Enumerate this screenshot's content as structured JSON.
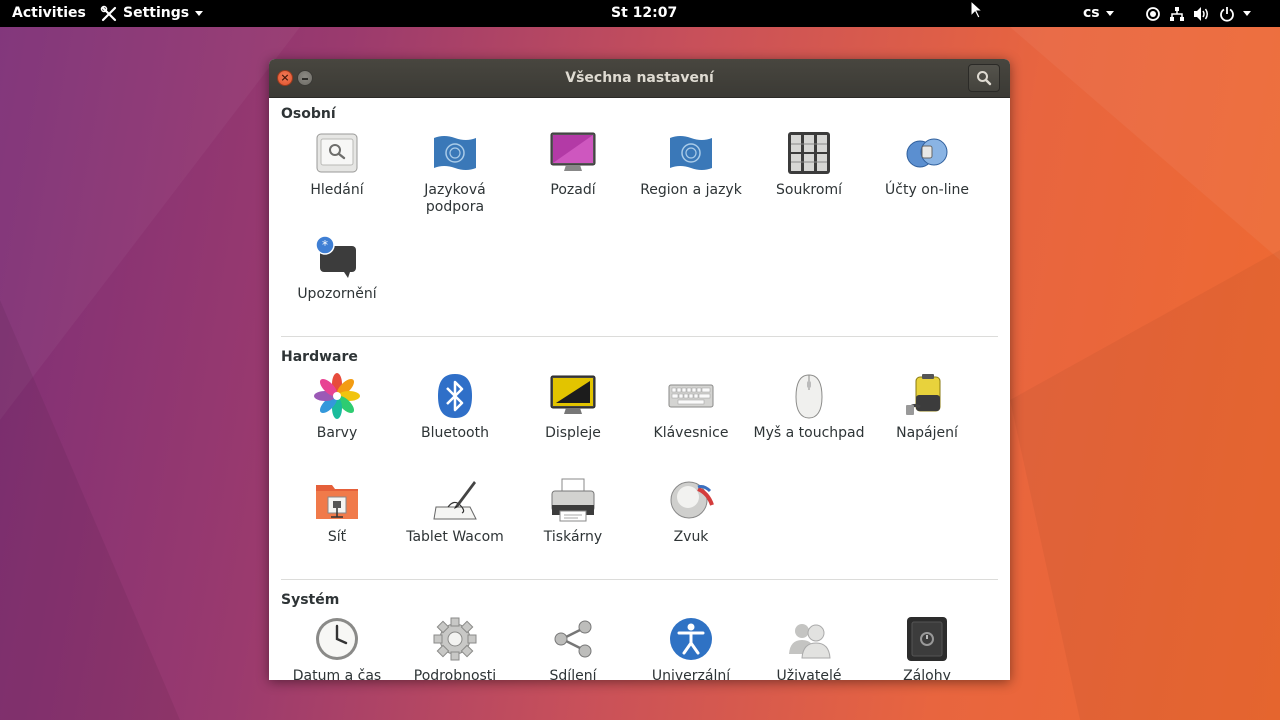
{
  "topbar": {
    "activities": "Activities",
    "app_menu": "Settings",
    "clock": "St 12:07",
    "keyboard_layout": "cs"
  },
  "window": {
    "title": "Všechna nastavení"
  },
  "sections": {
    "personal": {
      "title": "Osobní",
      "items": [
        {
          "label": "Hledání",
          "icon": "search-settings-icon"
        },
        {
          "label": "Jazyková podpora",
          "icon": "language-flag-icon"
        },
        {
          "label": "Pozadí",
          "icon": "background-monitor-icon"
        },
        {
          "label": "Region a jazyk",
          "icon": "region-flag-icon"
        },
        {
          "label": "Soukromí",
          "icon": "privacy-lock-icon"
        },
        {
          "label": "Účty on-line",
          "icon": "online-accounts-icon"
        },
        {
          "label": "Upozornění",
          "icon": "notifications-icon"
        }
      ]
    },
    "hardware": {
      "title": "Hardware",
      "items": [
        {
          "label": "Barvy",
          "icon": "color-flower-icon"
        },
        {
          "label": "Bluetooth",
          "icon": "bluetooth-icon"
        },
        {
          "label": "Displeje",
          "icon": "display-icon"
        },
        {
          "label": "Klávesnice",
          "icon": "keyboard-icon"
        },
        {
          "label": "Myš a touchpad",
          "icon": "mouse-icon"
        },
        {
          "label": "Napájení",
          "icon": "power-battery-icon"
        },
        {
          "label": "Síť",
          "icon": "network-folder-icon"
        },
        {
          "label": "Tablet Wacom",
          "icon": "wacom-tablet-icon"
        },
        {
          "label": "Tiskárny",
          "icon": "printer-icon"
        },
        {
          "label": "Zvuk",
          "icon": "sound-speaker-icon"
        }
      ]
    },
    "system": {
      "title": "Systém",
      "items": [
        {
          "label": "Datum a čas",
          "icon": "clock-icon"
        },
        {
          "label": "Podrobnosti",
          "icon": "gear-icon"
        },
        {
          "label": "Sdílení",
          "icon": "share-icon"
        },
        {
          "label": "Univerzální",
          "icon": "accessibility-icon"
        },
        {
          "label": "Uživatelé",
          "icon": "users-icon"
        },
        {
          "label": "Zálohy",
          "icon": "backup-safe-icon"
        }
      ]
    }
  }
}
